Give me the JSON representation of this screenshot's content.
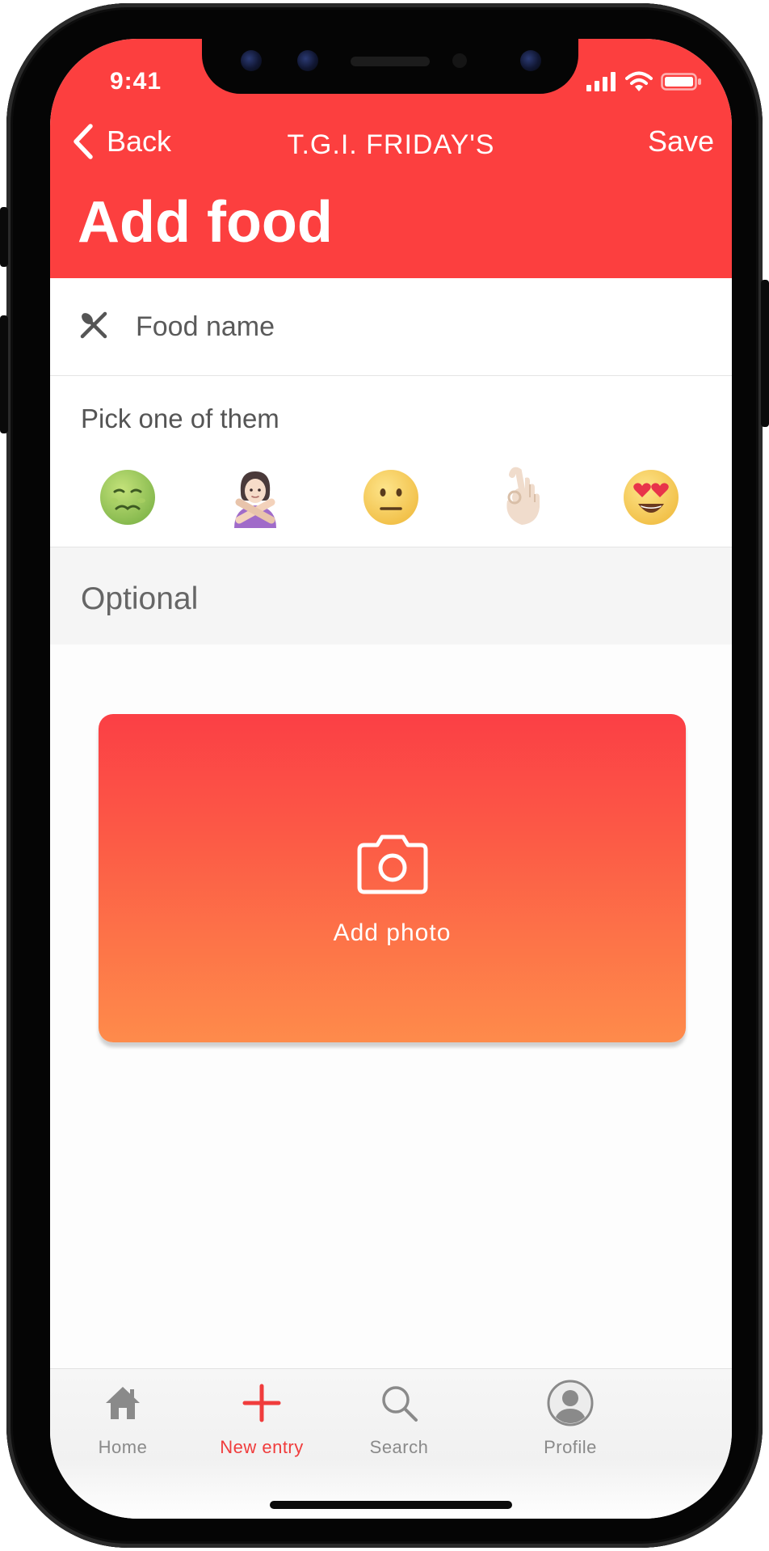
{
  "status_bar": {
    "time": "9:41"
  },
  "nav": {
    "back_label": "Back",
    "title": "T.G.I. FRIDAY'S",
    "save_label": "Save",
    "large_title": "Add food"
  },
  "food": {
    "placeholder": "Food name",
    "icon": "fork-knife-icon"
  },
  "pick": {
    "label": "Pick one of them",
    "options": [
      "nauseated-face",
      "person-gesturing-no",
      "neutral-face",
      "ok-hand",
      "heart-eyes-face"
    ]
  },
  "optional": {
    "label": "Optional"
  },
  "photo": {
    "label": "Add photo",
    "icon": "camera-icon"
  },
  "tabs": [
    {
      "label": "Home",
      "icon": "home-icon"
    },
    {
      "label": "New entry",
      "icon": "plus-icon"
    },
    {
      "label": "Search",
      "icon": "search-icon"
    },
    {
      "label": "Profile",
      "icon": "profile-icon"
    }
  ],
  "colors": {
    "accent": "#fc3f3f",
    "gradient_top": "#fb3f45",
    "gradient_bottom": "#fe8b4b",
    "active_tab": "#f03c3c",
    "inactive_tab": "#8a8a8a"
  }
}
